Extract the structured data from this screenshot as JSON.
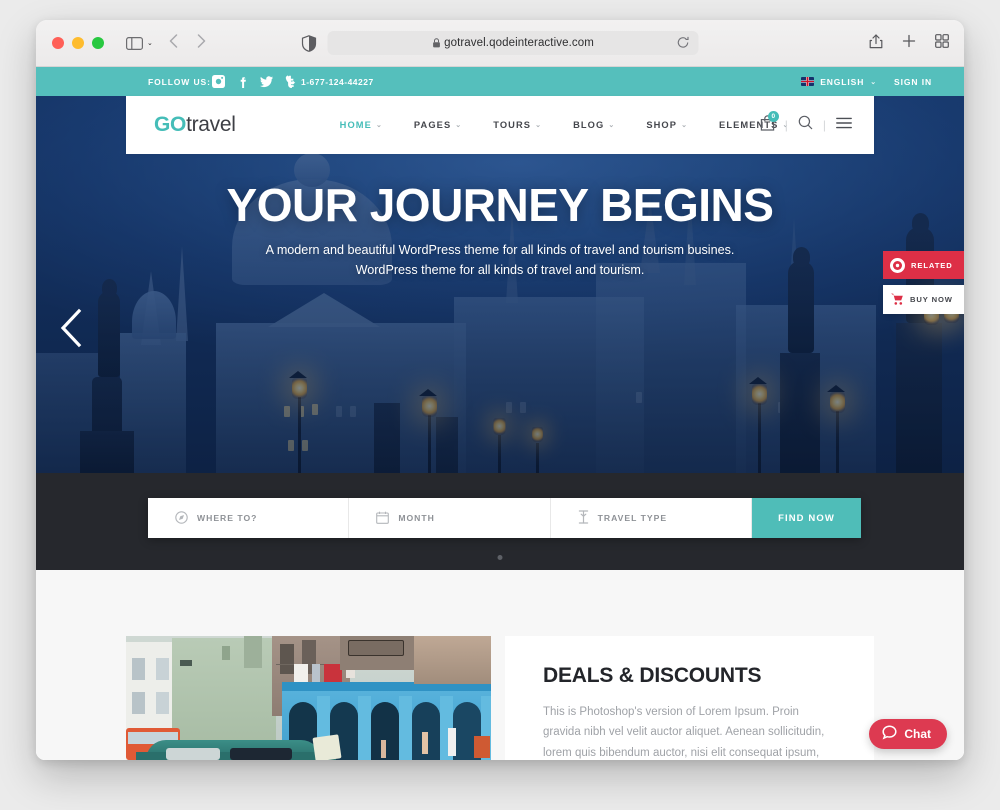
{
  "browser": {
    "url": "gotravel.qodeinteractive.com",
    "lock_icon": "lock-icon",
    "sidebar_icon": "sidebar-toggle-icon",
    "back_icon": "back-arrow-icon",
    "forward_icon": "forward-arrow-icon",
    "shield_icon": "privacy-shield-icon",
    "reload_icon": "reload-icon",
    "share_icon": "share-icon",
    "new_tab_icon": "plus-icon",
    "tab_overview_icon": "tab-overview-icon"
  },
  "topbar": {
    "follow_label": "FOLLOW US:",
    "socials": [
      {
        "name": "instagram-icon",
        "label": "Instagram"
      },
      {
        "name": "facebook-icon",
        "label": "Facebook"
      },
      {
        "name": "twitter-icon",
        "label": "Twitter"
      },
      {
        "name": "tumblr-icon",
        "label": "Tumblr"
      }
    ],
    "phone": "1-677-124-44227",
    "phone_icon": "phone-icon",
    "language": "ENGLISH",
    "language_flag": "uk-flag-icon",
    "sign_in": "SIGN IN",
    "bg_color": "#55bfbc"
  },
  "header": {
    "logo_go": "GO",
    "logo_travel": "travel",
    "nav": [
      {
        "label": "HOME",
        "active": true,
        "has_caret": true
      },
      {
        "label": "PAGES",
        "active": false,
        "has_caret": true
      },
      {
        "label": "TOURS",
        "active": false,
        "has_caret": true
      },
      {
        "label": "BLOG",
        "active": false,
        "has_caret": true
      },
      {
        "label": "SHOP",
        "active": false,
        "has_caret": true
      },
      {
        "label": "ELEMENTS",
        "active": false,
        "has_caret": true
      }
    ],
    "cart_icon": "shopping-bag-icon",
    "cart_count": "0",
    "search_icon": "search-icon",
    "menu_icon": "hamburger-menu-icon",
    "accent_color": "#45bdb8"
  },
  "hero": {
    "title": "YOUR JOURNEY BEGINS",
    "subtitle_line1": "A modern and beautiful WordPress theme for all kinds of travel and tourism busines.",
    "subtitle_line2": "WordPress theme for all kinds of travel and tourism.",
    "prev_icon": "chevron-left-icon",
    "slide_dot": "slider-dot"
  },
  "float_buttons": {
    "related_label": "RELATED",
    "related_icon": "related-circle-icon",
    "related_color": "#dd2f46",
    "buy_now_label": "BUY NOW",
    "buy_now_icon": "shopping-cart-icon"
  },
  "search_widget": {
    "fields": [
      {
        "label": "WHERE TO?",
        "icon": "compass-icon"
      },
      {
        "label": "MONTH",
        "icon": "calendar-icon"
      },
      {
        "label": "TRAVEL TYPE",
        "icon": "travel-type-icon"
      }
    ],
    "submit_label": "FIND NOW",
    "submit_color": "#4fbdb8"
  },
  "deals": {
    "image_alt": "havana-street-photo",
    "title": "DEALS & DISCOUNTS",
    "body": "This is Photoshop's version of Lorem Ipsum. Proin gravida nibh vel velit auctor aliquet. Aenean sollicitudin, lorem quis bibendum auctor, nisi elit consequat ipsum, nec sagittis sem nibh id elit."
  },
  "chat": {
    "label": "Chat",
    "icon": "chat-bubble-icon",
    "color": "#dd3a51"
  }
}
